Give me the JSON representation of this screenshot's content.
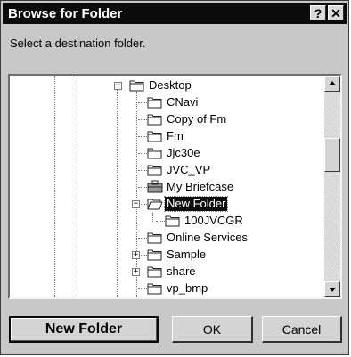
{
  "window": {
    "title": "Browse for Folder",
    "help_icon": "help-icon",
    "close_icon": "close-icon"
  },
  "prompt": "Select a destination folder.",
  "tree": {
    "items": [
      {
        "label": "Desktop",
        "icon": "folder-icon",
        "expander": "−"
      },
      {
        "label": "CNavi",
        "icon": "folder-icon"
      },
      {
        "label": "Copy of Fm",
        "icon": "folder-icon"
      },
      {
        "label": "Fm",
        "icon": "folder-icon"
      },
      {
        "label": "Jjc30e",
        "icon": "folder-icon"
      },
      {
        "label": "JVC_VP",
        "icon": "folder-icon"
      },
      {
        "label": "My Briefcase",
        "icon": "briefcase-icon"
      },
      {
        "label": "New Folder",
        "icon": "open-folder-icon",
        "expander": "−",
        "selected": true
      },
      {
        "label": "100JVCGR",
        "icon": "folder-icon"
      },
      {
        "label": "Online Services",
        "icon": "folder-icon"
      },
      {
        "label": "Sample",
        "icon": "folder-icon",
        "expander": "+"
      },
      {
        "label": "share",
        "icon": "folder-icon",
        "expander": "+"
      },
      {
        "label": "vp_bmp",
        "icon": "folder-icon"
      }
    ]
  },
  "scrollbar": {
    "up_icon": "scroll-up-arrow-icon",
    "down_icon": "scroll-down-arrow-icon"
  },
  "buttons": {
    "new_folder": "New Folder",
    "ok": "OK",
    "cancel": "Cancel"
  }
}
